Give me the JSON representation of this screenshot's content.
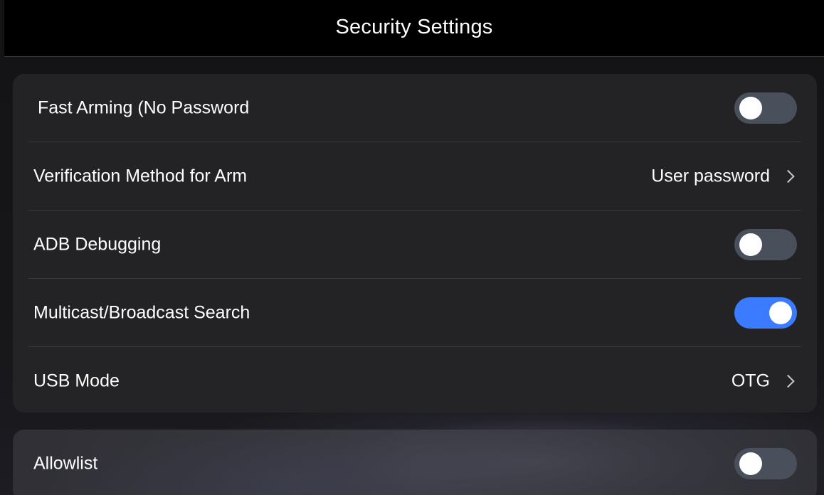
{
  "header": {
    "title": "Security Settings"
  },
  "settings": {
    "rows": [
      {
        "label": "Fast Arming (No Password",
        "type": "toggle",
        "state": "off"
      },
      {
        "label": "Verification Method for Arm",
        "type": "link",
        "value": "User password"
      },
      {
        "label": "ADB Debugging",
        "type": "toggle",
        "state": "off"
      },
      {
        "label": "Multicast/Broadcast Search",
        "type": "toggle",
        "state": "on"
      },
      {
        "label": "USB Mode",
        "type": "link",
        "value": "OTG"
      }
    ]
  },
  "allowlist": {
    "label": "Allowlist",
    "type": "toggle",
    "state": "off"
  },
  "colors": {
    "toggle_on": "#3a7bff",
    "toggle_off": "#4a4f5c",
    "background": "#141416",
    "card": "#242426"
  }
}
